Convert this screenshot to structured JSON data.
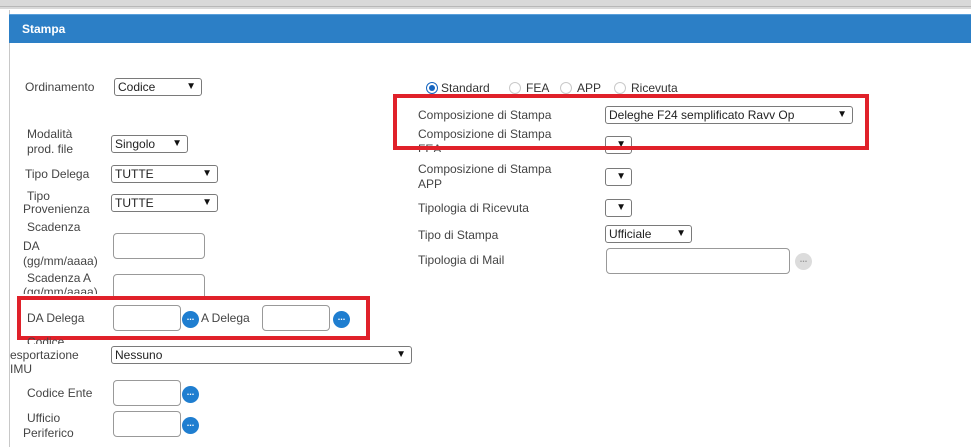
{
  "dialog": {
    "title": "Stampa"
  },
  "left": {
    "ordinamento": {
      "label": "Ordinamento",
      "value": "Codice"
    },
    "modalita": {
      "label_line1": "Modalità",
      "label_line2": "prod. file",
      "value": "Singolo"
    },
    "tipo_delega": {
      "label": "Tipo Delega",
      "value": "TUTTE"
    },
    "tipo_provenienza": {
      "label_line1": "Tipo",
      "label_line2": "Provenienza",
      "value": "TUTTE"
    },
    "scadenza_da": {
      "label_line1": "Scadenza",
      "label_line2": "DA",
      "label_line3": "(gg/mm/aaaa)",
      "value": ""
    },
    "scadenza_a": {
      "label_line1": "Scadenza A",
      "label_line2": "(gg/mm/aaaa)",
      "value": ""
    },
    "da_delega": {
      "label": "DA Delega",
      "value": ""
    },
    "a_delega": {
      "label": "A Delega",
      "value": ""
    },
    "codice_esportazione": {
      "label_line1": "Codice",
      "label_line2": "esportazione",
      "label_line3": "IMU",
      "value": "Nessuno"
    },
    "codice_ente": {
      "label": "Codice Ente",
      "value": ""
    },
    "ufficio": {
      "label_line1": "Ufficio",
      "label_line2": "Periferico",
      "value": ""
    }
  },
  "right": {
    "radios": [
      {
        "label": "Standard",
        "checked": true
      },
      {
        "label": "FEA",
        "checked": false
      },
      {
        "label": "APP",
        "checked": false
      },
      {
        "label": "Ricevuta",
        "checked": false
      }
    ],
    "composizione": {
      "label": "Composizione di Stampa",
      "value": "Deleghe F24 semplificato Ravv Op"
    },
    "composizione_fea": {
      "label_line1": "Composizione di Stampa",
      "label_line2": "FEA",
      "value": ""
    },
    "composizione_app": {
      "label_line1": "Composizione di Stampa",
      "label_line2": "APP",
      "value": ""
    },
    "tipologia_ricevuta": {
      "label": "Tipologia di Ricevuta",
      "value": ""
    },
    "tipo_stampa": {
      "label": "Tipo di Stampa",
      "value": "Ufficiale"
    },
    "tipologia_mail": {
      "label": "Tipologia di Mail",
      "value": ""
    }
  },
  "icons": {
    "ellipsis": "...",
    "dropdown_arrow": "▼"
  },
  "colors": {
    "titlebar": "#2c7fc6",
    "highlight": "#e0212a",
    "lookup_button": "#1f7ed0"
  }
}
